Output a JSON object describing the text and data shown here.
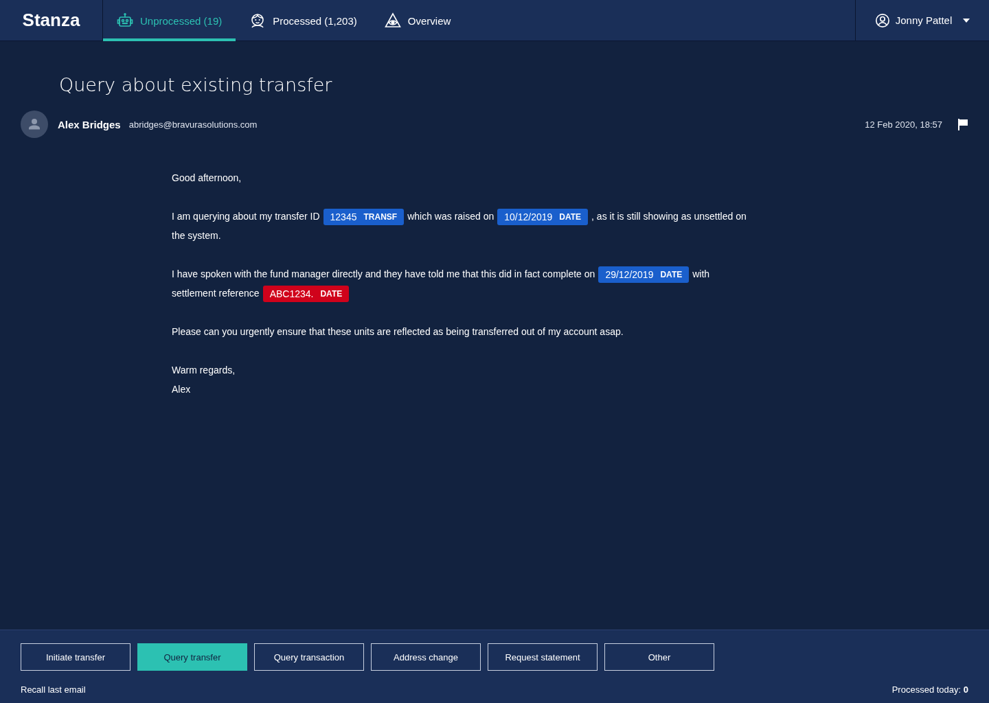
{
  "app": {
    "logo": "Stanza"
  },
  "tabs": [
    {
      "label": "Unprocessed (19)",
      "kind": "queue",
      "selected": true
    },
    {
      "label": "Processed (1,203)",
      "kind": "done",
      "selected": false
    },
    {
      "label": "Overview",
      "kind": "overview",
      "selected": false
    }
  ],
  "user": {
    "name": "Jonny Pattel"
  },
  "email": {
    "subject": "Query about existing transfer",
    "sender_name": "Alex Bridges",
    "sender_email": "abridges@bravurasolutions.com",
    "date": "12 Feb 2020, 18:57",
    "flagged": true,
    "paragraphs": [
      [
        {
          "kind": "text",
          "text": "Good afternoon,"
        }
      ],
      [
        {
          "kind": "text",
          "text": "I am querying about my transfer ID"
        },
        {
          "kind": "entity",
          "value": "12345",
          "label": "TRANSF",
          "color": "#1a5fcc"
        },
        {
          "kind": "text",
          "text": "which was raised on"
        },
        {
          "kind": "entity",
          "value": "10/12/2019",
          "label": "DATE",
          "color": "#1a5fcc"
        },
        {
          "kind": "text",
          "text": ", as it is still showing as unsettled on"
        },
        {
          "kind": "break"
        },
        {
          "kind": "text",
          "text": "the system."
        }
      ],
      [
        {
          "kind": "text",
          "text": "I have spoken with the fund manager directly and they have told me that this did in fact complete on"
        },
        {
          "kind": "entity",
          "value": "29/12/2019",
          "label": "DATE",
          "color": "#1a5fcc"
        },
        {
          "kind": "text",
          "text": "with"
        },
        {
          "kind": "break"
        },
        {
          "kind": "text",
          "text": "settlement reference"
        },
        {
          "kind": "entity",
          "value": "ABC1234.",
          "label": "DATE",
          "color": "#d0021b"
        }
      ],
      [
        {
          "kind": "text",
          "text": "Please can you urgently ensure that these units are reflected as being transferred out of my account asap."
        }
      ],
      [
        {
          "kind": "text",
          "text": "Warm regards,"
        },
        {
          "kind": "break"
        },
        {
          "kind": "text",
          "text": "Alex"
        }
      ]
    ]
  },
  "actions": [
    {
      "label": "Initiate transfer",
      "selected": false
    },
    {
      "label": "Query transfer",
      "selected": true
    },
    {
      "label": "Query transaction",
      "selected": false
    },
    {
      "label": "Address change",
      "selected": false
    },
    {
      "label": "Request statement",
      "selected": false
    },
    {
      "label": "Other",
      "selected": false
    }
  ],
  "footer": {
    "recall": "Recall last email",
    "processed_label": "Processed today:",
    "processed_count": "0"
  }
}
